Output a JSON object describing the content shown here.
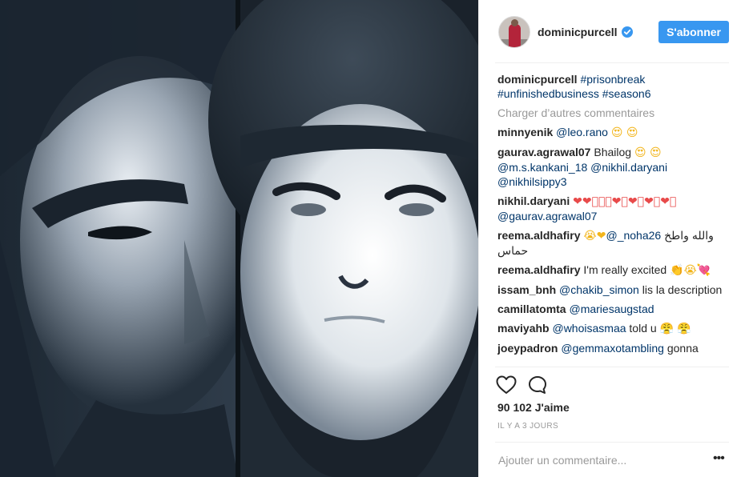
{
  "post": {
    "username": "dominicpurcell",
    "follow_label": "S'abonner",
    "caption": {
      "username": "dominicpurcell",
      "hashtags": "#prisonbreak #unfinishedbusiness #season6"
    },
    "load_more": "Charger d’autres commentaires",
    "comments": [
      {
        "user": "minnyenik",
        "mention": "@leo.rano",
        "text": "",
        "emoji": "😍 😍"
      },
      {
        "user": "gaurav.agrawal07",
        "text": "Bhailog",
        "emoji": "😍 😍",
        "mentions": "@m.s.kankani_18 @nikhil.daryani @nikhilsippy3"
      },
      {
        "user": "nikhil.daryani",
        "emoji": "❤❤⃝⃝⃝❤⃝❤⃝❤⃝❤⃝",
        "mention": "@gaurav.agrawal07"
      },
      {
        "user": "reema.aldhafiry",
        "emoji": "😭❤",
        "mention": "@_noha26",
        "text": "والله واطخ حماس"
      },
      {
        "user": "reema.aldhafiry",
        "text": "I'm really excited",
        "emoji": "👏😭💘"
      },
      {
        "user": "issam_bnh",
        "mention": "@chakib_simon",
        "text": "lis la description"
      },
      {
        "user": "camillatomta",
        "mention": "@mariesaugstad",
        "text": ""
      },
      {
        "user": "maviyahb",
        "mention": "@whoisasmaa",
        "text": "told u",
        "emoji": "😤 😤"
      },
      {
        "user": "joeypadron",
        "mention": "@gemmaxotambling",
        "text": "gonna"
      }
    ],
    "likes": "90 102 J'aime",
    "time": "IL Y A 3 JOURS",
    "add_comment_placeholder": "Ajouter un commentaire...",
    "more_glyph": "•••",
    "icons": [
      "heart-icon",
      "comment-icon",
      "verified-badge-icon",
      "more-options-icon"
    ],
    "colors": {
      "accent": "#3897f0",
      "link": "#003569",
      "muted": "#999999"
    }
  }
}
